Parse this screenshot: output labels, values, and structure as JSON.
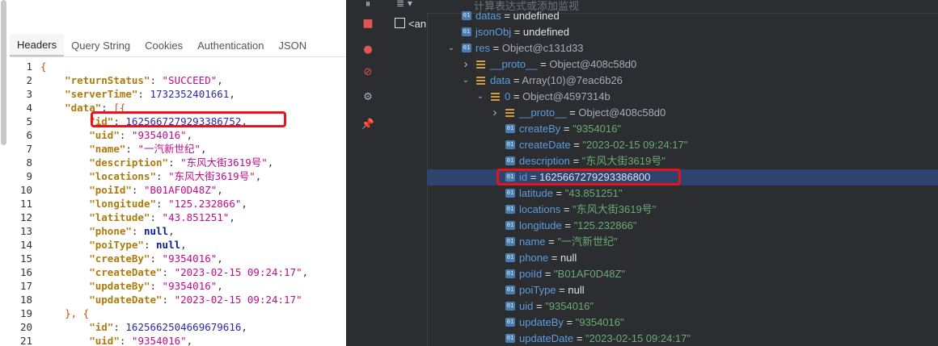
{
  "left": {
    "tabs": [
      {
        "label": "Headers",
        "active": true
      },
      {
        "label": "Query String",
        "active": false
      },
      {
        "label": "Cookies",
        "active": false
      },
      {
        "label": "Authentication",
        "active": false
      },
      {
        "label": "JSON",
        "active": false
      }
    ],
    "code_lines": [
      {
        "n": "1",
        "tokens": [
          {
            "t": "{",
            "c": "br"
          }
        ]
      },
      {
        "n": "2",
        "tokens": [
          {
            "t": "    ",
            "c": "p"
          },
          {
            "t": "\"returnStatus\"",
            "c": "k"
          },
          {
            "t": ": ",
            "c": "p"
          },
          {
            "t": "\"SUCCEED\"",
            "c": "s"
          },
          {
            "t": ",",
            "c": "p"
          }
        ]
      },
      {
        "n": "3",
        "tokens": [
          {
            "t": "    ",
            "c": "p"
          },
          {
            "t": "\"serverTime\"",
            "c": "k"
          },
          {
            "t": ": ",
            "c": "p"
          },
          {
            "t": "1732352401661",
            "c": "n"
          },
          {
            "t": ",",
            "c": "p"
          }
        ]
      },
      {
        "n": "4",
        "tokens": [
          {
            "t": "    ",
            "c": "p"
          },
          {
            "t": "\"data\"",
            "c": "k"
          },
          {
            "t": ": ",
            "c": "p"
          },
          {
            "t": "[{",
            "c": "br"
          }
        ]
      },
      {
        "n": "5",
        "tokens": [
          {
            "t": "        ",
            "c": "p"
          },
          {
            "t": "\"id\"",
            "c": "k"
          },
          {
            "t": ": ",
            "c": "p"
          },
          {
            "t": "1625667279293386752",
            "c": "n"
          },
          {
            "t": ",",
            "c": "p"
          }
        ]
      },
      {
        "n": "6",
        "tokens": [
          {
            "t": "        ",
            "c": "p"
          },
          {
            "t": "\"uid\"",
            "c": "k"
          },
          {
            "t": ": ",
            "c": "p"
          },
          {
            "t": "\"9354016\"",
            "c": "s"
          },
          {
            "t": ",",
            "c": "p"
          }
        ]
      },
      {
        "n": "7",
        "tokens": [
          {
            "t": "        ",
            "c": "p"
          },
          {
            "t": "\"name\"",
            "c": "k"
          },
          {
            "t": ": ",
            "c": "p"
          },
          {
            "t": "\"一汽新世纪\"",
            "c": "s"
          },
          {
            "t": ",",
            "c": "p"
          }
        ]
      },
      {
        "n": "8",
        "tokens": [
          {
            "t": "        ",
            "c": "p"
          },
          {
            "t": "\"description\"",
            "c": "k"
          },
          {
            "t": ": ",
            "c": "p"
          },
          {
            "t": "\"东风大街3619号\"",
            "c": "s"
          },
          {
            "t": ",",
            "c": "p"
          }
        ]
      },
      {
        "n": "9",
        "tokens": [
          {
            "t": "        ",
            "c": "p"
          },
          {
            "t": "\"locations\"",
            "c": "k"
          },
          {
            "t": ": ",
            "c": "p"
          },
          {
            "t": "\"东风大街3619号\"",
            "c": "s"
          },
          {
            "t": ",",
            "c": "p"
          }
        ]
      },
      {
        "n": "10",
        "tokens": [
          {
            "t": "        ",
            "c": "p"
          },
          {
            "t": "\"poiId\"",
            "c": "k"
          },
          {
            "t": ": ",
            "c": "p"
          },
          {
            "t": "\"B01AF0D48Z\"",
            "c": "s"
          },
          {
            "t": ",",
            "c": "p"
          }
        ]
      },
      {
        "n": "11",
        "tokens": [
          {
            "t": "        ",
            "c": "p"
          },
          {
            "t": "\"longitude\"",
            "c": "k"
          },
          {
            "t": ": ",
            "c": "p"
          },
          {
            "t": "\"125.232866\"",
            "c": "s"
          },
          {
            "t": ",",
            "c": "p"
          }
        ]
      },
      {
        "n": "12",
        "tokens": [
          {
            "t": "        ",
            "c": "p"
          },
          {
            "t": "\"latitude\"",
            "c": "k"
          },
          {
            "t": ": ",
            "c": "p"
          },
          {
            "t": "\"43.851251\"",
            "c": "s"
          },
          {
            "t": ",",
            "c": "p"
          }
        ]
      },
      {
        "n": "13",
        "tokens": [
          {
            "t": "        ",
            "c": "p"
          },
          {
            "t": "\"phone\"",
            "c": "k"
          },
          {
            "t": ": ",
            "c": "p"
          },
          {
            "t": "null",
            "c": "b"
          },
          {
            "t": ",",
            "c": "p"
          }
        ]
      },
      {
        "n": "14",
        "tokens": [
          {
            "t": "        ",
            "c": "p"
          },
          {
            "t": "\"poiType\"",
            "c": "k"
          },
          {
            "t": ": ",
            "c": "p"
          },
          {
            "t": "null",
            "c": "b"
          },
          {
            "t": ",",
            "c": "p"
          }
        ]
      },
      {
        "n": "15",
        "tokens": [
          {
            "t": "        ",
            "c": "p"
          },
          {
            "t": "\"createBy\"",
            "c": "k"
          },
          {
            "t": ": ",
            "c": "p"
          },
          {
            "t": "\"9354016\"",
            "c": "s"
          },
          {
            "t": ",",
            "c": "p"
          }
        ]
      },
      {
        "n": "16",
        "tokens": [
          {
            "t": "        ",
            "c": "p"
          },
          {
            "t": "\"createDate\"",
            "c": "k"
          },
          {
            "t": ": ",
            "c": "p"
          },
          {
            "t": "\"2023-02-15 09:24:17\"",
            "c": "s"
          },
          {
            "t": ",",
            "c": "p"
          }
        ]
      },
      {
        "n": "17",
        "tokens": [
          {
            "t": "        ",
            "c": "p"
          },
          {
            "t": "\"updateBy\"",
            "c": "k"
          },
          {
            "t": ": ",
            "c": "p"
          },
          {
            "t": "\"9354016\"",
            "c": "s"
          },
          {
            "t": ",",
            "c": "p"
          }
        ]
      },
      {
        "n": "18",
        "tokens": [
          {
            "t": "        ",
            "c": "p"
          },
          {
            "t": "\"updateDate\"",
            "c": "k"
          },
          {
            "t": ": ",
            "c": "p"
          },
          {
            "t": "\"2023-02-15 09:24:17\"",
            "c": "s"
          }
        ]
      },
      {
        "n": "19",
        "tokens": [
          {
            "t": "    ",
            "c": "p"
          },
          {
            "t": "}, {",
            "c": "br"
          }
        ]
      },
      {
        "n": "20",
        "tokens": [
          {
            "t": "        ",
            "c": "p"
          },
          {
            "t": "\"id\"",
            "c": "k"
          },
          {
            "t": ": ",
            "c": "p"
          },
          {
            "t": "1625662504669679616",
            "c": "n"
          },
          {
            "t": ",",
            "c": "p"
          }
        ]
      },
      {
        "n": "21",
        "tokens": [
          {
            "t": "        ",
            "c": "p"
          },
          {
            "t": "\"uid\"",
            "c": "k"
          },
          {
            "t": ": ",
            "c": "p"
          },
          {
            "t": "\"9354016\"",
            "c": "s"
          },
          {
            "t": ",",
            "c": "p"
          }
        ]
      }
    ]
  },
  "right": {
    "eval_placeholder": "计算表达式或添加监视",
    "frame_label": "<an",
    "tools": [
      "list-icon",
      "stop-icon",
      "breakpoints-icon",
      "mute-breakpoints-icon",
      "settings-icon",
      "pin-icon"
    ],
    "tree": [
      {
        "indent": 0,
        "arrow": "",
        "icon": "field",
        "name": "datas",
        "eq": " = ",
        "val": "undefined",
        "vt": "fval",
        "sel": false
      },
      {
        "indent": 0,
        "arrow": "",
        "icon": "field",
        "name": "jsonObj",
        "eq": " = ",
        "val": "undefined",
        "vt": "fval",
        "sel": false
      },
      {
        "indent": 0,
        "arrow": "down",
        "icon": "field",
        "name": "res",
        "eq": " = ",
        "val": "Object@c131d33",
        "vt": "fobj",
        "sel": false
      },
      {
        "indent": 1,
        "arrow": "right",
        "icon": "list",
        "name": "__proto__",
        "eq": " = ",
        "val": "Object@408c58d0",
        "vt": "fobj",
        "sel": false
      },
      {
        "indent": 1,
        "arrow": "down",
        "icon": "list",
        "name": "data",
        "eq": " = ",
        "val": "Array(10)@7eac6b26",
        "vt": "fobj",
        "sel": false
      },
      {
        "indent": 2,
        "arrow": "down",
        "icon": "list",
        "name": "0",
        "eq": " = ",
        "val": "Object@4597314b",
        "vt": "fobj",
        "sel": false
      },
      {
        "indent": 3,
        "arrow": "right",
        "icon": "list",
        "name": "__proto__",
        "eq": " = ",
        "val": "Object@408c58d0",
        "vt": "fobj",
        "sel": false
      },
      {
        "indent": 3,
        "arrow": "",
        "icon": "field",
        "name": "createBy",
        "eq": " = ",
        "val": "\"9354016\"",
        "vt": "fstr",
        "sel": false
      },
      {
        "indent": 3,
        "arrow": "",
        "icon": "field",
        "name": "createDate",
        "eq": " = ",
        "val": "\"2023-02-15 09:24:17\"",
        "vt": "fstr",
        "sel": false
      },
      {
        "indent": 3,
        "arrow": "",
        "icon": "field",
        "name": "description",
        "eq": " = ",
        "val": "\"东风大街3619号\"",
        "vt": "fstr",
        "sel": false
      },
      {
        "indent": 3,
        "arrow": "",
        "icon": "field",
        "name": "id",
        "eq": " = ",
        "val": "1625667279293386800",
        "vt": "fval",
        "sel": true
      },
      {
        "indent": 3,
        "arrow": "",
        "icon": "field",
        "name": "latitude",
        "eq": " = ",
        "val": "\"43.851251\"",
        "vt": "fstr",
        "sel": false
      },
      {
        "indent": 3,
        "arrow": "",
        "icon": "field",
        "name": "locations",
        "eq": " = ",
        "val": "\"东风大街3619号\"",
        "vt": "fstr",
        "sel": false
      },
      {
        "indent": 3,
        "arrow": "",
        "icon": "field",
        "name": "longitude",
        "eq": " = ",
        "val": "\"125.232866\"",
        "vt": "fstr",
        "sel": false
      },
      {
        "indent": 3,
        "arrow": "",
        "icon": "field",
        "name": "name",
        "eq": " = ",
        "val": "\"一汽新世纪\"",
        "vt": "fstr",
        "sel": false
      },
      {
        "indent": 3,
        "arrow": "",
        "icon": "field",
        "name": "phone",
        "eq": " = ",
        "val": "null",
        "vt": "fval",
        "sel": false
      },
      {
        "indent": 3,
        "arrow": "",
        "icon": "field",
        "name": "poiId",
        "eq": " = ",
        "val": "\"B01AF0D48Z\"",
        "vt": "fstr",
        "sel": false
      },
      {
        "indent": 3,
        "arrow": "",
        "icon": "field",
        "name": "poiType",
        "eq": " = ",
        "val": "null",
        "vt": "fval",
        "sel": false
      },
      {
        "indent": 3,
        "arrow": "",
        "icon": "field",
        "name": "uid",
        "eq": " = ",
        "val": "\"9354016\"",
        "vt": "fstr",
        "sel": false
      },
      {
        "indent": 3,
        "arrow": "",
        "icon": "field",
        "name": "updateBy",
        "eq": " = ",
        "val": "\"9354016\"",
        "vt": "fstr",
        "sel": false
      },
      {
        "indent": 3,
        "arrow": "",
        "icon": "field",
        "name": "updateDate",
        "eq": " = ",
        "val": "\"2023-02-15 09:24:17\"",
        "vt": "fstr",
        "sel": false
      }
    ]
  }
}
